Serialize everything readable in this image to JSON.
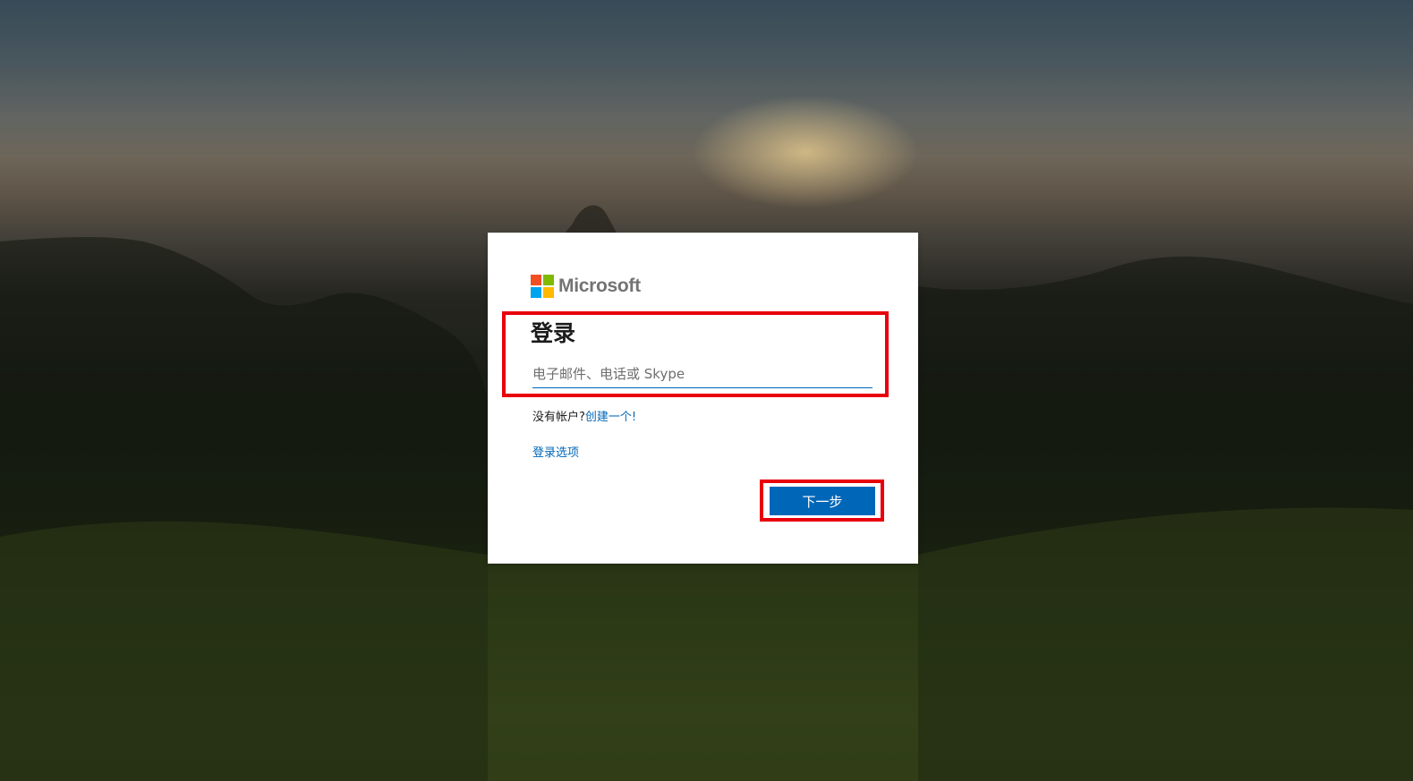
{
  "brand": {
    "name": "Microsoft",
    "colors": [
      "#f25022",
      "#7fba00",
      "#00a4ef",
      "#ffb900"
    ]
  },
  "signin": {
    "title": "登录",
    "email_placeholder": "电子邮件、电话或 Skype",
    "email_value": "",
    "no_account_text": "没有帐户?",
    "create_link": "创建一个!",
    "signin_options": "登录选项",
    "next_button": "下一步"
  },
  "colors": {
    "accent": "#0067b8",
    "highlight": "#e8000b"
  }
}
